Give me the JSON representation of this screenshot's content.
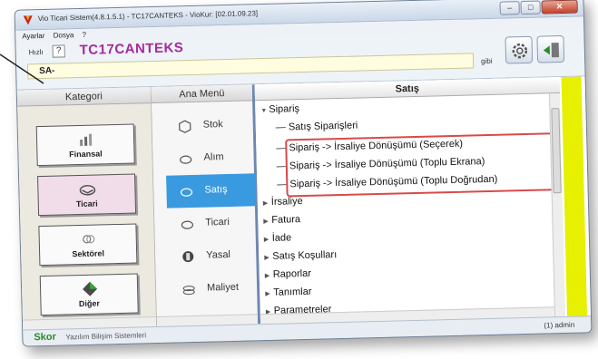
{
  "window": {
    "title": "Vio Ticari Sistem(4.8.1.5.1) - TC17CANTEKS - VioKur: [02.01.09.23]"
  },
  "menubar": [
    "Ayarlar",
    "Dosya",
    "?"
  ],
  "toolbar": {
    "hizli_label": "Hızlı",
    "help_glyph": "?",
    "company": "TC17CANTEKS",
    "code_value": "SA-",
    "gibi_label": "gibi"
  },
  "categories": {
    "header": "Kategori",
    "items": [
      {
        "label": "Finansal",
        "icon": "chart-icon"
      },
      {
        "label": "Ticari",
        "icon": "handshake-icon",
        "active": true
      },
      {
        "label": "Sektörel",
        "icon": "rings-icon"
      },
      {
        "label": "Diğer",
        "icon": "diamond-icon"
      }
    ]
  },
  "main_menu": {
    "header": "Ana Menü",
    "items": [
      {
        "label": "Stok",
        "icon": "box-icon"
      },
      {
        "label": "Alım",
        "icon": "handshake-icon"
      },
      {
        "label": "Satış",
        "icon": "handshake-icon",
        "active": true
      },
      {
        "label": "Ticari",
        "icon": "handshake-icon"
      },
      {
        "label": "Yasal",
        "icon": "law-icon"
      },
      {
        "label": "Maliyet",
        "icon": "coins-icon"
      }
    ]
  },
  "tree": {
    "header": "Satış",
    "items": [
      {
        "label": "Sipariş",
        "expanded": true
      },
      {
        "label": "Satış Siparişleri"
      },
      {
        "label": "Sipariş -> İrsaliye Dönüşümü (Seçerek)"
      },
      {
        "label": "Sipariş -> İrsaliye Dönüşümü (Toplu Ekrana)"
      },
      {
        "label": "Sipariş -> İrsaliye Dönüşümü (Toplu Doğrudan)"
      },
      {
        "label": "İrsaliye"
      },
      {
        "label": "Fatura"
      },
      {
        "label": "İade"
      },
      {
        "label": "Satış Koşulları"
      },
      {
        "label": "Raporlar"
      },
      {
        "label": "Tanımlar"
      },
      {
        "label": "Parametreler"
      }
    ]
  },
  "statusbar": {
    "brand": "Skor",
    "company": "Yazılım Bilişim Sistemleri",
    "user": "(1) admin"
  },
  "colors": {
    "company": "#a52a9a",
    "highlight": "#d94a4a",
    "active_menu": "#3a9ae0",
    "yellow_bar": "#e6f000",
    "brand_green": "#2a8a2a"
  }
}
